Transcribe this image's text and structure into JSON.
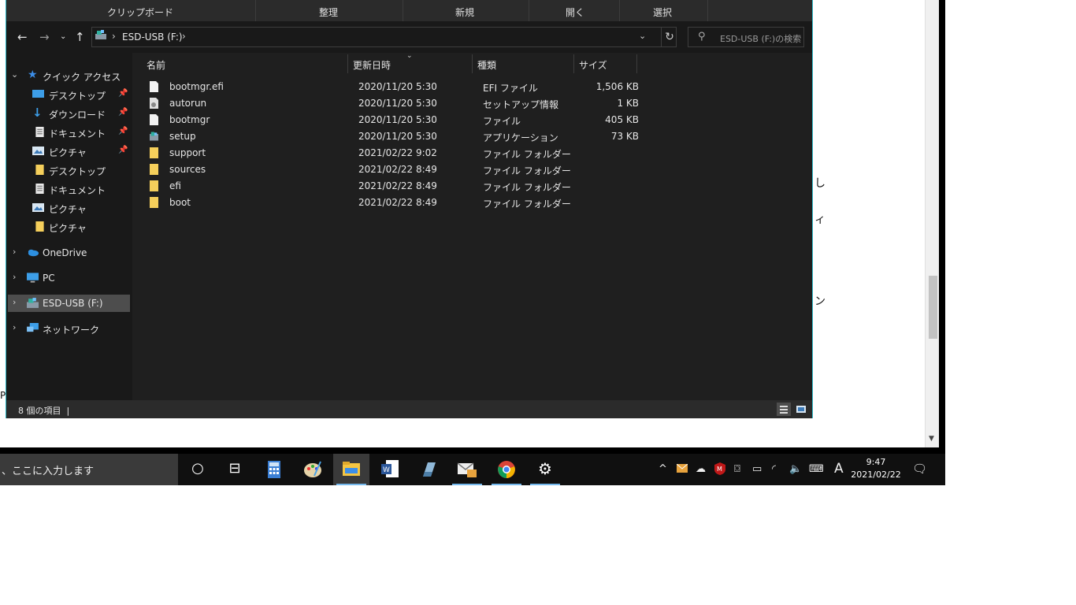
{
  "ribbon": {
    "groups": [
      "クリップボード",
      "整理",
      "新規",
      "開く",
      "選択"
    ]
  },
  "address": {
    "drive": "ESD-USB (F:)"
  },
  "search": {
    "placeholder": "ESD-USB (F:)の検索"
  },
  "nav": {
    "quick_access": "クイック アクセス",
    "pinned": [
      "デスクトップ",
      "ダウンロード",
      "ドキュメント",
      "ピクチャ"
    ],
    "recent": [
      "デスクトップ",
      "ドキュメント",
      "ピクチャ",
      "ピクチャ"
    ],
    "onedrive": "OneDrive",
    "pc": "PC",
    "usb": "ESD-USB (F:)",
    "network": "ネットワーク"
  },
  "columns": {
    "name": "名前",
    "modified": "更新日時",
    "type": "種類",
    "size": "サイズ"
  },
  "files": [
    {
      "name": "bootmgr.efi",
      "date": "2020/11/20 5:30",
      "type": "EFI ファイル",
      "size": "1,506 KB",
      "icon": "file-icon"
    },
    {
      "name": "autorun",
      "date": "2020/11/20 5:30",
      "type": "セットアップ情報",
      "size": "1 KB",
      "icon": "settings-file-icon"
    },
    {
      "name": "bootmgr",
      "date": "2020/11/20 5:30",
      "type": "ファイル",
      "size": "405 KB",
      "icon": "file-icon"
    },
    {
      "name": "setup",
      "date": "2020/11/20 5:30",
      "type": "アプリケーション",
      "size": "73 KB",
      "icon": "setup-app-icon"
    },
    {
      "name": "support",
      "date": "2021/02/22 9:02",
      "type": "ファイル フォルダー",
      "size": "",
      "icon": "folder-icon"
    },
    {
      "name": "sources",
      "date": "2021/02/22 8:49",
      "type": "ファイル フォルダー",
      "size": "",
      "icon": "folder-icon"
    },
    {
      "name": "efi",
      "date": "2021/02/22 8:49",
      "type": "ファイル フォルダー",
      "size": "",
      "icon": "folder-icon"
    },
    {
      "name": "boot",
      "date": "2021/02/22 8:49",
      "type": "ファイル フォルダー",
      "size": "",
      "icon": "folder-icon"
    }
  ],
  "status": {
    "item_count": "8 個の項目"
  },
  "taskbar": {
    "search_text": "、ここに入力します",
    "ime": "A",
    "time": "9:47",
    "date": "2021/02/22"
  },
  "background_fragments": [
    "ィ",
    "ン",
    "ィ",
    "ン",
    "Pr"
  ]
}
